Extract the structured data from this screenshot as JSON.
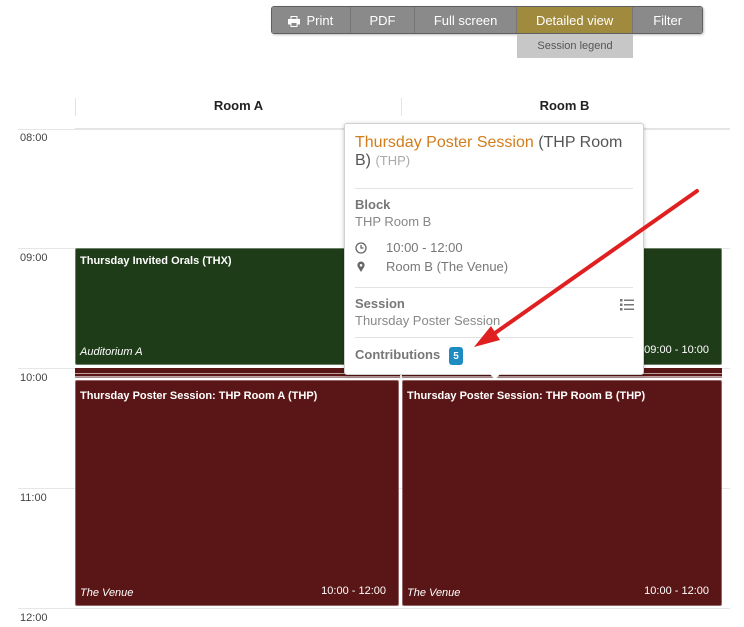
{
  "toolbar": {
    "buttons": [
      {
        "label": "Print",
        "icon": "printer-icon"
      },
      {
        "label": "PDF"
      },
      {
        "label": "Full screen"
      },
      {
        "label": "Detailed view",
        "active": true
      },
      {
        "label": "Filter"
      }
    ],
    "session_legend": "Session legend",
    "active_color": "#a08a3d"
  },
  "rooms": [
    "Room A",
    "Room B"
  ],
  "hours": [
    "08:00",
    "09:00",
    "10:00",
    "11:00",
    "12:00"
  ],
  "blocks": {
    "invited_orals": {
      "title": "Thursday Invited Orals (THX)",
      "location": "Auditorium A",
      "time": "09:00 - 10:00",
      "color": "#1f3c18"
    },
    "poster_a": {
      "title": "Thursday Poster Session: THP Room A (THP)",
      "location": "The Venue",
      "time": "10:00 - 12:00",
      "color": "#5a1616"
    },
    "poster_b": {
      "title": "Thursday Poster Session: THP Room B (THP)",
      "location": "The Venue",
      "time": "10:00 - 12:00",
      "color": "#5a1616"
    }
  },
  "popup": {
    "title": "Thursday Poster Session",
    "title_suffix": " (THP Room B)",
    "code": "(THP)",
    "block_label": "Block",
    "block_value": "THP Room B",
    "time": "10:00 - 12:00",
    "location": "Room B (The Venue)",
    "session_label": "Session",
    "session_value": "Thursday Poster Session",
    "contributions_label": "Contributions",
    "contributions_count": "5",
    "title_color": "#d27d1a",
    "badge_color": "#1e8bc3"
  },
  "annotation": {
    "arrow_color": "#e02020"
  }
}
